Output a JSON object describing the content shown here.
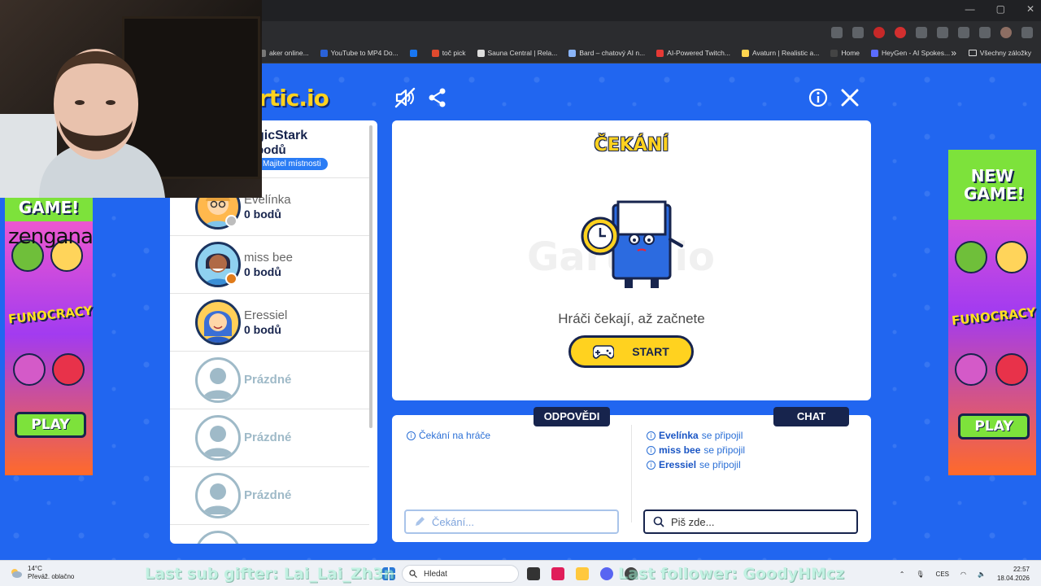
{
  "browser": {
    "bookmarks": [
      {
        "label": "aker online...",
        "color": "#777777"
      },
      {
        "label": "YouTube to MP4 Do...",
        "color": "#2a62d9"
      },
      {
        "label": "",
        "color": "#1877f2"
      },
      {
        "label": "toč pick",
        "color": "#e04a2e"
      },
      {
        "label": "Sauna Central | Rela...",
        "color": "#dddddd"
      },
      {
        "label": "Bard – chatový AI n...",
        "color": "#8ab4f8"
      },
      {
        "label": "AI-Powered Twitch...",
        "color": "#e53935"
      },
      {
        "label": "Avaturn | Realistic a...",
        "color": "#ffd54f"
      },
      {
        "label": "Home",
        "color": "#444444"
      },
      {
        "label": "HeyGen - AI Spokes...",
        "color": "#5b6cff"
      }
    ],
    "more": "»",
    "all_bookmarks": "Všechny záložky"
  },
  "game": {
    "logo": "rtic.io",
    "waiting_title": "ČEKÁNÍ",
    "watermark": "Gartic.io",
    "waiting_message": "Hráči čekají, až začnete",
    "start_label": "START",
    "answers_tab": "ODPOVĚDI",
    "chat_tab": "CHAT",
    "answers_status": "Čekání na hráče",
    "answers_placeholder": "Čekání...",
    "chat_placeholder": "Piš zde...",
    "chat_messages": [
      {
        "name": "Evelínka",
        "text": "se připojil"
      },
      {
        "name": "miss bee",
        "text": "se připojil"
      },
      {
        "name": "Eressiel",
        "text": "se připojil"
      }
    ]
  },
  "players": [
    {
      "name": "gicStark",
      "score": "bodů",
      "badge": "Majitel místnosti",
      "status_color": ""
    },
    {
      "name": "Evelínka",
      "score": "0 bodů",
      "status_color": "#bdbdbd"
    },
    {
      "name": "miss bee",
      "score": "0 bodů",
      "status_color": "#e07b1a"
    },
    {
      "name": "Eressiel",
      "score": "0 bodů",
      "status_color": ""
    }
  ],
  "empty_slots": [
    "Prázdné",
    "Prázdné",
    "Prázdné"
  ],
  "ads": {
    "left_top": "GAME!",
    "right_top": "NEW GAME!",
    "fun_text": "FUNOCRACY",
    "play": "PLAY",
    "brand": "zengana"
  },
  "taskbar": {
    "temperature": "14°C",
    "weather": "Převáž. oblačno",
    "search_placeholder": "Hledat",
    "language": "CES",
    "time": "22:57",
    "date": "18.04.2026"
  },
  "overlay": {
    "ticker_left": "Last sub gifter: Lai_Lai_Zh3n",
    "ticker_right": "Last follower: GoodyHMcz"
  },
  "colors": {
    "page_bg": "#2166f0",
    "navy": "#17244d",
    "yellow": "#ffd21f",
    "link_blue": "#2a6fd6"
  }
}
